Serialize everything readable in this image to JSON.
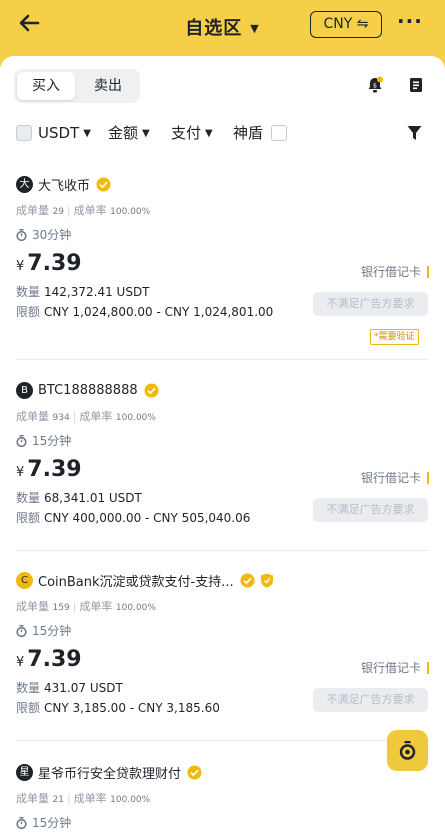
{
  "header": {
    "title": "自选区",
    "currency": "CNY"
  },
  "tabs": {
    "buy": "买入",
    "sell": "卖出"
  },
  "filters": {
    "asset": "USDT",
    "amount": "金额",
    "payment": "支付",
    "shield": "神盾"
  },
  "listings": [
    {
      "avatar": "大",
      "name": "大飞收币",
      "orders_label": "成单量",
      "orders": "29",
      "rate_label": "成单率",
      "rate": "100.00%",
      "time": "30分钟",
      "currency_symbol": "¥",
      "price": "7.39",
      "qty_label": "数量",
      "qty": "142,372.41 USDT",
      "limit_label": "限额",
      "limit": "CNY 1,024,800.00 - CNY 1,024,801.00",
      "payment": "银行借记卡",
      "action": "不满足广告方要求",
      "tag": "*需要验证"
    },
    {
      "avatar": "B",
      "name": "BTC188888888",
      "orders_label": "成单量",
      "orders": "934",
      "rate_label": "成单率",
      "rate": "100.00%",
      "time": "15分钟",
      "currency_symbol": "¥",
      "price": "7.39",
      "qty_label": "数量",
      "qty": "68,341.01 USDT",
      "limit_label": "限额",
      "limit": "CNY 400,000.00 - CNY 505,040.06",
      "payment": "银行借记卡",
      "action": "不满足广告方要求"
    },
    {
      "avatar": "C",
      "name": "CoinBank沉淀或贷款支付-支持...",
      "orders_label": "成单量",
      "orders": "159",
      "rate_label": "成单率",
      "rate": "100.00%",
      "time": "15分钟",
      "currency_symbol": "¥",
      "price": "7.39",
      "qty_label": "数量",
      "qty": "431.07 USDT",
      "limit_label": "限额",
      "limit": "CNY 3,185.00 - CNY 3,185.60",
      "payment": "银行借记卡",
      "action": "不满足广告方要求"
    },
    {
      "avatar": "星",
      "name": "星爷币行安全贷款理财付",
      "orders_label": "成单量",
      "orders": "21",
      "rate_label": "成单率",
      "rate": "100.00%",
      "time": "15分钟"
    }
  ],
  "colors": {
    "brand": "#f0b90b",
    "header_bg": "#f5cf47"
  }
}
